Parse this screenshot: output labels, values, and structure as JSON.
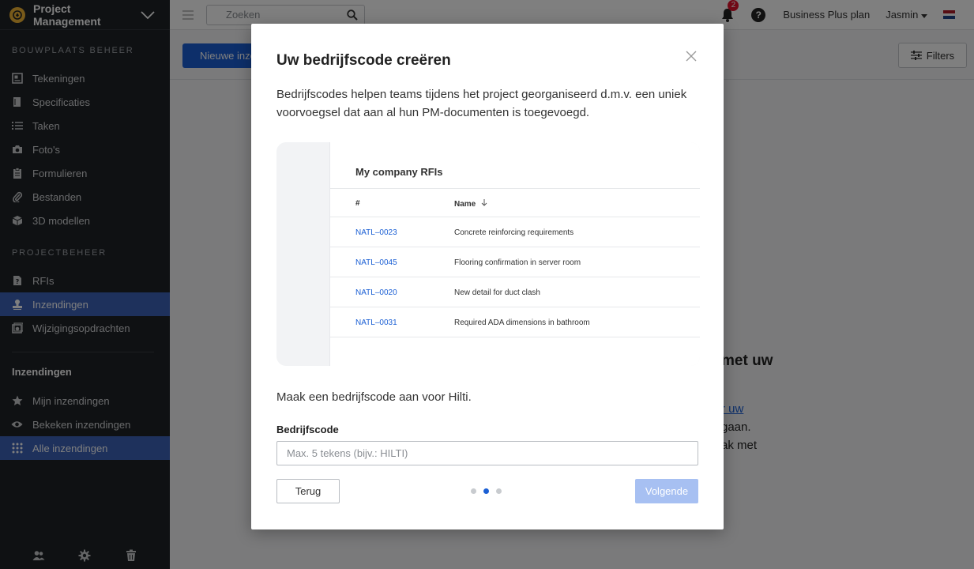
{
  "sidebar": {
    "title": "Project Management",
    "sections": {
      "site": "BOUWPLAATS BEHEER",
      "project": "PROJECTBEHEER"
    },
    "site_items": [
      {
        "label": "Tekeningen",
        "icon": "drawing-icon"
      },
      {
        "label": "Specificaties",
        "icon": "book-icon"
      },
      {
        "label": "Taken",
        "icon": "list-icon"
      },
      {
        "label": "Foto's",
        "icon": "camera-icon"
      },
      {
        "label": "Formulieren",
        "icon": "clipboard-icon"
      },
      {
        "label": "Bestanden",
        "icon": "paperclip-icon"
      },
      {
        "label": "3D modellen",
        "icon": "cube-icon"
      }
    ],
    "project_items": [
      {
        "label": "RFIs",
        "icon": "rfi-icon"
      },
      {
        "label": "Inzendingen",
        "icon": "stamp-icon",
        "active": true
      },
      {
        "label": "Wijzigingsopdrachten",
        "icon": "change-order-icon"
      }
    ],
    "sub_title": "Inzendingen",
    "sub_items": [
      {
        "label": "Mijn inzendingen",
        "icon": "star-icon"
      },
      {
        "label": "Bekeken inzendingen",
        "icon": "eye-icon"
      },
      {
        "label": "Alle inzendingen",
        "icon": "grid-icon",
        "active": true
      }
    ]
  },
  "topbar": {
    "search_placeholder": "Zoeken",
    "notification_count": "2",
    "help": "?",
    "plan": "Business Plus plan",
    "user": "Jasmin"
  },
  "main": {
    "new_button": "Nieuwe inzending",
    "filters_button": "Filters",
    "bg_heading": "met uw",
    "bg_link": "r uw",
    "bg_text1": "gaan.",
    "bg_text2": "ak met"
  },
  "modal": {
    "title": "Uw bedrijfscode creëren",
    "description": "Bedrijfscodes helpen teams tijdens het project georganiseerd d.m.v. een uniek voorvoegsel dat aan al hun PM-documenten is toegevoegd.",
    "illustration": {
      "title": "My company RFIs",
      "col_number": "#",
      "col_name": "Name",
      "rows": [
        {
          "code": "NATL–0023",
          "name": "Concrete reinforcing requirements"
        },
        {
          "code": "NATL–0045",
          "name": "Flooring confirmation in server room"
        },
        {
          "code": "NATL–0020",
          "name": "New detail for duct clash"
        },
        {
          "code": "NATL–0031",
          "name": "Required ADA dimensions in bathroom"
        }
      ]
    },
    "prompt": "Maak een bedrijfscode aan voor Hilti.",
    "field_label": "Bedrijfscode",
    "field_placeholder": "Max. 5 tekens (bijv.: HILTI)",
    "field_value": "",
    "back_button": "Terug",
    "next_button": "Volgende",
    "step": 2,
    "total_steps": 3
  },
  "colors": {
    "accent": "#1b5fd4",
    "sidebar_bg": "#1f2226",
    "sidebar_active": "#3d62b8",
    "disabled_button": "#a7c0f2"
  }
}
